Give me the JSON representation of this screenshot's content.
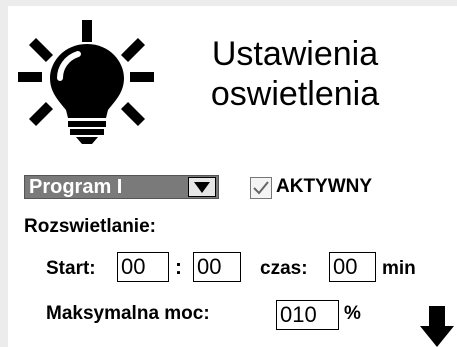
{
  "title": {
    "line1": "Ustawienia",
    "line2": "oswietlenia"
  },
  "program": {
    "selected": "Program I"
  },
  "active": {
    "label": "AKTYWNY",
    "checked": true
  },
  "section": {
    "label": "Rozswietlanie:"
  },
  "start": {
    "label": "Start:",
    "hours": "00",
    "separator": ":",
    "minutes": "00"
  },
  "duration": {
    "label": "czas:",
    "value": "00",
    "unit": "min"
  },
  "power": {
    "label": "Maksymalna moc:",
    "value": "010",
    "unit": "%"
  },
  "icons": {
    "bulb": "lightbulb-icon",
    "dropdown": "chevron-down-icon",
    "check": "check-icon",
    "next": "arrow-down-icon"
  }
}
